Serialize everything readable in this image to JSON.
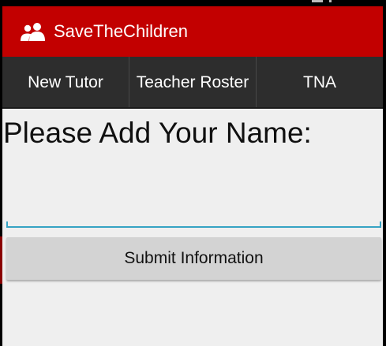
{
  "app": {
    "title": "SaveTheChildren",
    "icon": "people-icon",
    "colors": {
      "action_bar": "#c20000",
      "tab_bar": "#2d2d2d",
      "input_accent": "#36a3c4",
      "background": "#efefef"
    }
  },
  "tabs": [
    {
      "label": "New Tutor"
    },
    {
      "label": "Teacher Roster"
    },
    {
      "label": "TNA"
    }
  ],
  "form": {
    "prompt": "Please Add Your Name:",
    "name_value": "",
    "submit_label": "Submit Information"
  }
}
